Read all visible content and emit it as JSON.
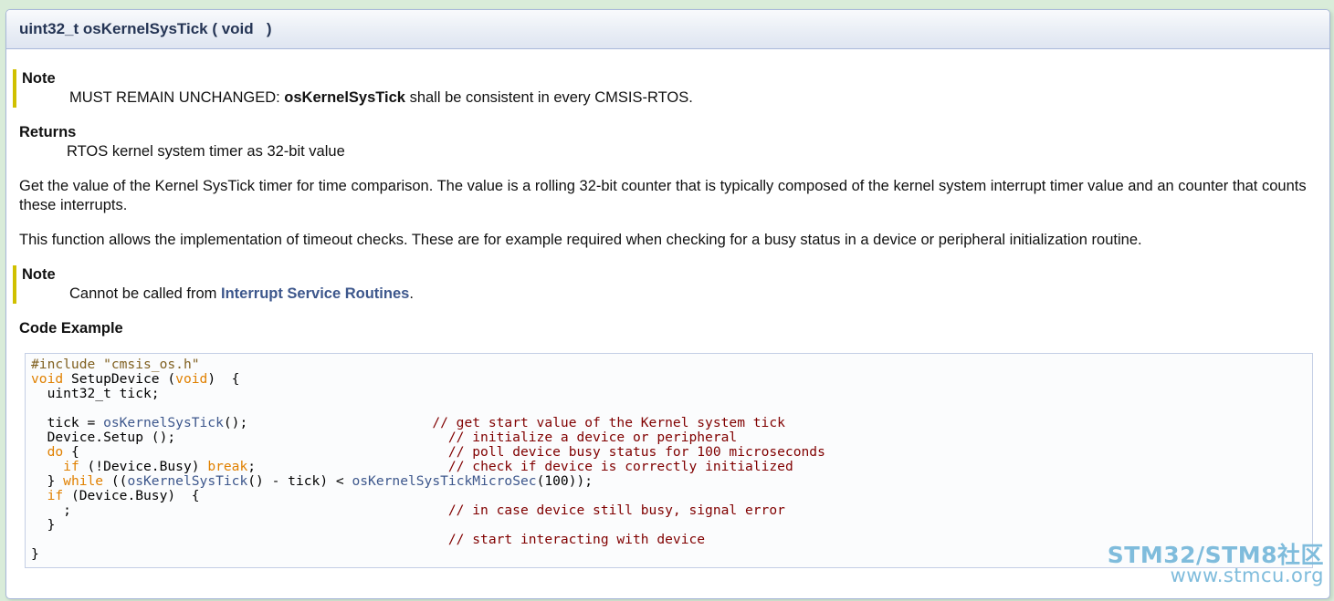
{
  "header": {
    "prototype": "uint32_t osKernelSysTick ( void   )"
  },
  "note1": {
    "title": "Note",
    "prefix": "MUST REMAIN UNCHANGED: ",
    "bold": "osKernelSysTick",
    "suffix": " shall be consistent in every CMSIS-RTOS."
  },
  "returns": {
    "title": "Returns",
    "text": "RTOS kernel system timer as 32-bit value"
  },
  "paragraph1": "Get the value of the Kernel SysTick timer for time comparison. The value is a rolling 32-bit counter that is typically composed of the kernel system interrupt timer value and an counter that counts these interrupts.",
  "paragraph2": "This function allows the implementation of timeout checks. These are for example required when checking for a busy status in a device or peripheral initialization routine.",
  "note2": {
    "title": "Note",
    "prefix": "Cannot be called from ",
    "link": "Interrupt Service Routines",
    "suffix": "."
  },
  "code_example": {
    "title": "Code Example",
    "lines": [
      [
        {
          "t": "#include ",
          "c": "pp"
        },
        {
          "t": "\"cmsis_os.h\"",
          "c": "pp"
        }
      ],
      [
        {
          "t": "void",
          "c": "kw"
        },
        {
          "t": " SetupDevice (",
          "c": ""
        },
        {
          "t": "void",
          "c": "kw"
        },
        {
          "t": ")  {",
          "c": ""
        }
      ],
      [
        {
          "t": "  uint32_t tick;",
          "c": ""
        }
      ],
      [
        {
          "t": "",
          "c": ""
        }
      ],
      [
        {
          "t": "  tick = ",
          "c": ""
        },
        {
          "t": "osKernelSysTick",
          "c": "fn"
        },
        {
          "t": "();                       ",
          "c": ""
        },
        {
          "t": "// get start value of the Kernel system tick",
          "c": "cm"
        }
      ],
      [
        {
          "t": "  Device.Setup ();                                  ",
          "c": ""
        },
        {
          "t": "// initialize a device or peripheral",
          "c": "cm"
        }
      ],
      [
        {
          "t": "  ",
          "c": ""
        },
        {
          "t": "do",
          "c": "kw"
        },
        {
          "t": " {                                              ",
          "c": ""
        },
        {
          "t": "// poll device busy status for 100 microseconds",
          "c": "cm"
        }
      ],
      [
        {
          "t": "    ",
          "c": ""
        },
        {
          "t": "if",
          "c": "kw"
        },
        {
          "t": " (!Device.Busy) ",
          "c": ""
        },
        {
          "t": "break",
          "c": "kw"
        },
        {
          "t": ";                        ",
          "c": ""
        },
        {
          "t": "// check if device is correctly initialized",
          "c": "cm"
        }
      ],
      [
        {
          "t": "  } ",
          "c": ""
        },
        {
          "t": "while",
          "c": "kw"
        },
        {
          "t": " ((",
          "c": ""
        },
        {
          "t": "osKernelSysTick",
          "c": "fn"
        },
        {
          "t": "() - tick) < ",
          "c": ""
        },
        {
          "t": "osKernelSysTickMicroSec",
          "c": "fn"
        },
        {
          "t": "(100));",
          "c": ""
        }
      ],
      [
        {
          "t": "  ",
          "c": ""
        },
        {
          "t": "if",
          "c": "kw"
        },
        {
          "t": " (Device.Busy)  {",
          "c": ""
        }
      ],
      [
        {
          "t": "    ;                                               ",
          "c": ""
        },
        {
          "t": "// in case device still busy, signal error",
          "c": "cm"
        }
      ],
      [
        {
          "t": "  }",
          "c": ""
        }
      ],
      [
        {
          "t": "                                                    ",
          "c": ""
        },
        {
          "t": "// start interacting with device",
          "c": "cm"
        }
      ],
      [
        {
          "t": "}",
          "c": ""
        }
      ]
    ]
  },
  "watermark": {
    "line1": "STM32/STM8社区",
    "line2": "www.stmcu.org"
  },
  "colors": {
    "note_bar": "#d0c000",
    "link": "#3d578c",
    "comment": "#800000",
    "keyword": "#e08000",
    "preprocessor": "#806020"
  }
}
